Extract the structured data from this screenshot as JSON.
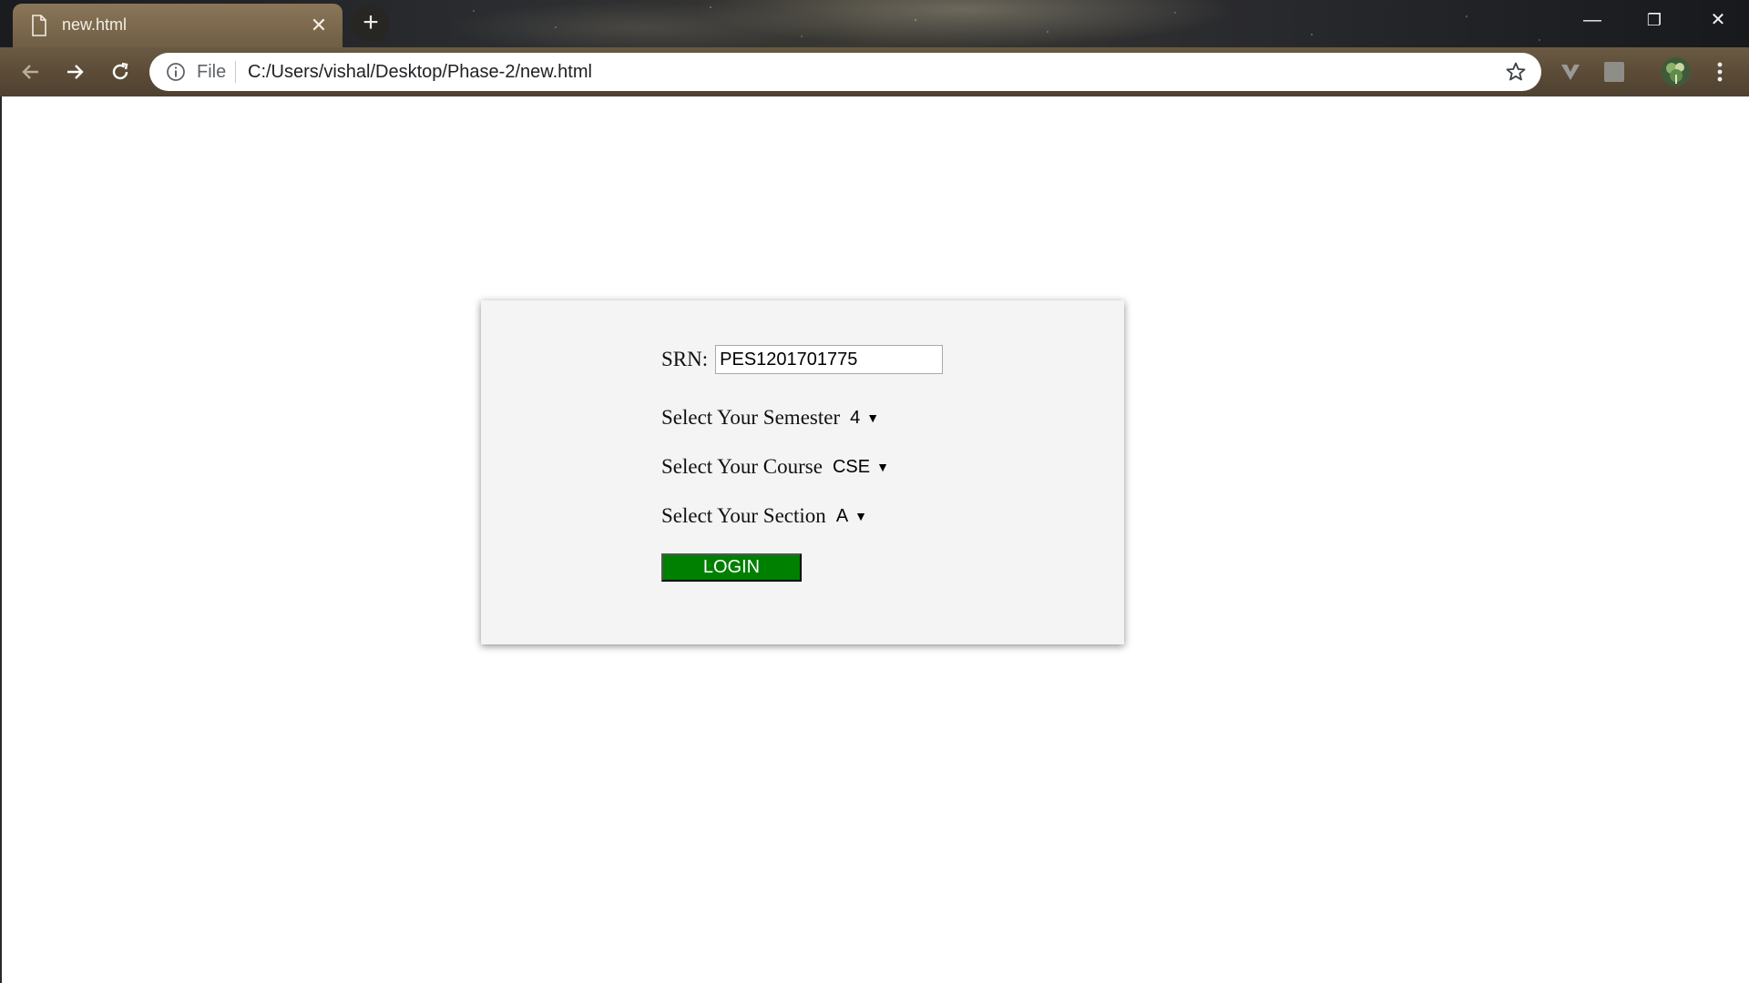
{
  "browser": {
    "tab_title": "new.html",
    "new_tab_symbol": "+",
    "close_symbol": "✕",
    "address": {
      "scheme_label": "File",
      "url": "C:/Users/vishal/Desktop/Phase-2/new.html"
    },
    "window_controls": {
      "minimize": "—",
      "restore": "❐",
      "close": "✕"
    },
    "icons": [
      "doc-icon",
      "back-icon",
      "forward-icon",
      "reload-icon",
      "info-icon",
      "star-icon",
      "vivaldi-extension-icon",
      "extension-square-icon",
      "profile-avatar-icon",
      "kebab-menu-icon"
    ]
  },
  "form": {
    "srn_label": "SRN:",
    "srn_value": "PES1201701775",
    "semester_label": "Select Your Semester",
    "semester_value": "4",
    "course_label": "Select Your Course",
    "course_value": "CSE",
    "section_label": "Select Your Section",
    "section_value": "A",
    "caret": "▼",
    "login_label": "LOGIN"
  },
  "colors": {
    "login_button": "#008000",
    "card_background": "#f4f4f4",
    "page_background": "#ffffff"
  }
}
